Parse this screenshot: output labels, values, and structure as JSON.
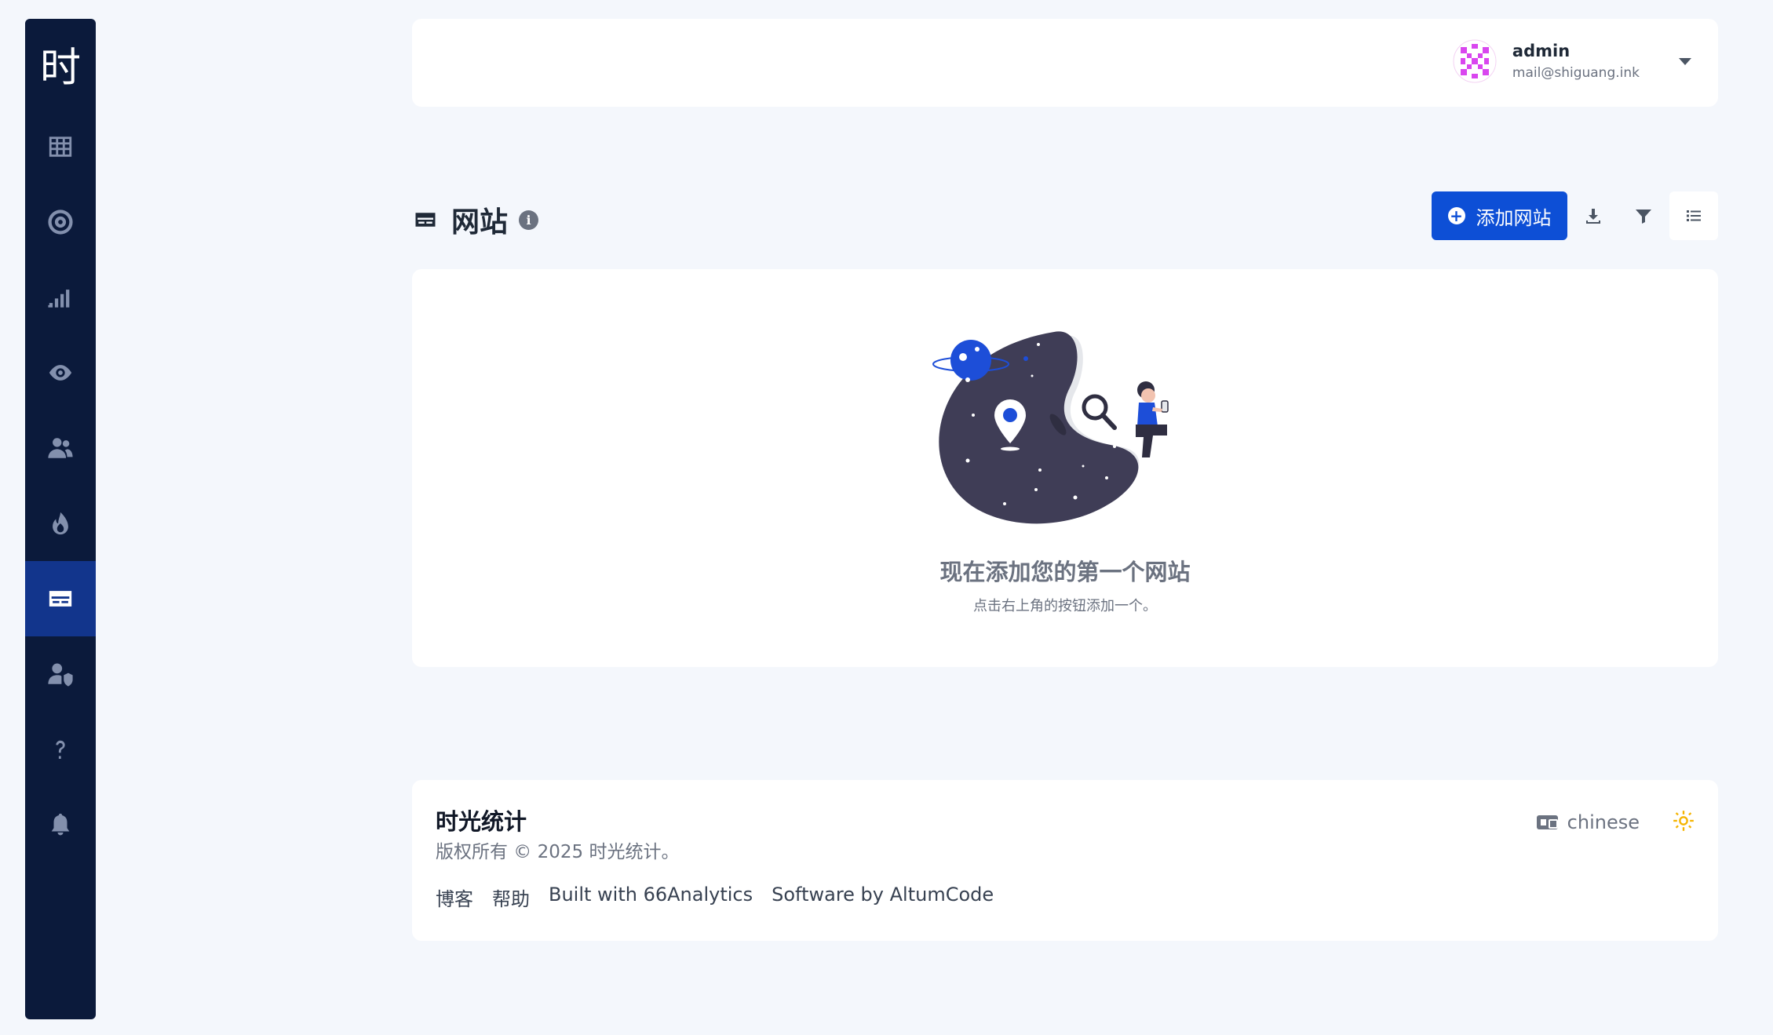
{
  "sidebar": {
    "logo": "时",
    "items": [
      {
        "name": "dashboard",
        "icon": "grid-icon",
        "active": false
      },
      {
        "name": "goals",
        "icon": "target-icon",
        "active": false
      },
      {
        "name": "realtime",
        "icon": "signal-bars-icon",
        "active": false
      },
      {
        "name": "visitors",
        "icon": "eye-icon",
        "active": false
      },
      {
        "name": "users",
        "icon": "users-icon",
        "active": false
      },
      {
        "name": "heatmaps",
        "icon": "fire-icon",
        "active": false
      },
      {
        "name": "websites",
        "icon": "card-icon",
        "active": true
      },
      {
        "name": "team",
        "icon": "user-shield-icon",
        "active": false
      },
      {
        "name": "help",
        "icon": "question-icon",
        "active": false
      },
      {
        "name": "notifications",
        "icon": "bell-icon",
        "active": false
      }
    ]
  },
  "header": {
    "user_name": "admin",
    "user_email": "mail@shiguang.ink"
  },
  "page": {
    "title": "网站",
    "add_button": "添加网站"
  },
  "empty_state": {
    "title": "现在添加您的第一个网站",
    "subtitle": "点击右上角的按钮添加一个。"
  },
  "footer": {
    "brand": "时光统计",
    "copyright": "版权所有 © 2025 时光统计。",
    "links": [
      "博客",
      "帮助",
      "Built with 66Analytics",
      "Software by AltumCode"
    ],
    "language": "chinese"
  },
  "colors": {
    "primary": "#0d4fd6",
    "sidebar_bg": "#0b1a3b",
    "sidebar_active": "#12358c",
    "page_bg": "#f4f7fc"
  }
}
